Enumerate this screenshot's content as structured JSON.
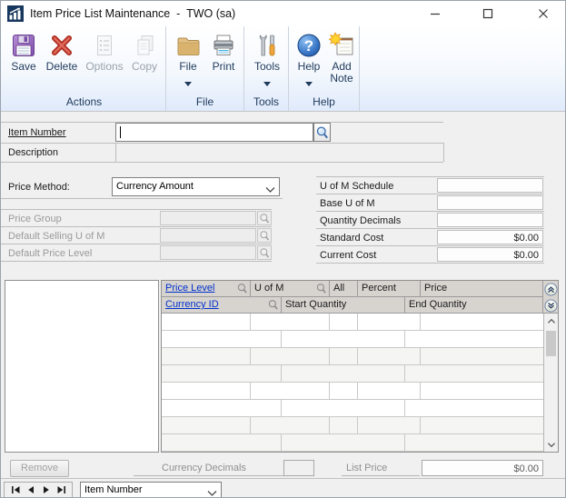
{
  "window": {
    "title": "Item Price List Maintenance  -  TWO (sa)"
  },
  "ribbon": {
    "groups": [
      {
        "label": "Actions",
        "items": [
          {
            "label": "Save",
            "disabled": false
          },
          {
            "label": "Delete",
            "disabled": false
          },
          {
            "label": "Options",
            "disabled": true
          },
          {
            "label": "Copy",
            "disabled": true
          }
        ]
      },
      {
        "label": "File",
        "items": [
          {
            "label": "File",
            "dropdown": true
          },
          {
            "label": "Print"
          }
        ]
      },
      {
        "label": "Tools",
        "items": [
          {
            "label": "Tools",
            "dropdown": true
          }
        ]
      },
      {
        "label": "Help",
        "items": [
          {
            "label": "Help",
            "dropdown": true
          },
          {
            "label": "Add Note"
          }
        ]
      }
    ]
  },
  "form": {
    "item_number": {
      "label": "Item Number",
      "value": ""
    },
    "description": {
      "label": "Description",
      "value": ""
    },
    "price_method": {
      "label": "Price Method:",
      "value": "Currency Amount"
    },
    "price_group": {
      "label": "Price Group",
      "value": ""
    },
    "default_selling_uofm": {
      "label": "Default Selling U of M",
      "value": ""
    },
    "default_price_level": {
      "label": "Default Price Level",
      "value": ""
    },
    "uofm_schedule": {
      "label": "U of M Schedule",
      "value": ""
    },
    "base_uofm": {
      "label": "Base U of M",
      "value": ""
    },
    "quantity_decimals": {
      "label": "Quantity Decimals",
      "value": ""
    },
    "standard_cost": {
      "label": "Standard Cost",
      "value": "$0.00"
    },
    "current_cost": {
      "label": "Current Cost",
      "value": "$0.00"
    }
  },
  "grid": {
    "header_row1": [
      "Price Level",
      "U of M",
      "All",
      "Percent",
      "Price"
    ],
    "header_row2": [
      "Currency ID",
      "Start Quantity",
      "End Quantity"
    ],
    "rows": []
  },
  "footer": {
    "remove_label": "Remove",
    "currency_decimals": {
      "label": "Currency Decimals",
      "value": ""
    },
    "list_price": {
      "label": "List Price",
      "value": "$0.00"
    }
  },
  "statusbar": {
    "browse_by": "Item Number"
  },
  "colors": {
    "link_blue": "#0030cc",
    "ribbon_text": "#1e395b",
    "header_gray": "#d7d4cf",
    "save_purple": "#8f5bb0",
    "delete_red": "#c23a2d",
    "help_blue": "#2763b8",
    "folder_tan": "#e3c083",
    "note_star_yellow": "#ffd22e"
  }
}
